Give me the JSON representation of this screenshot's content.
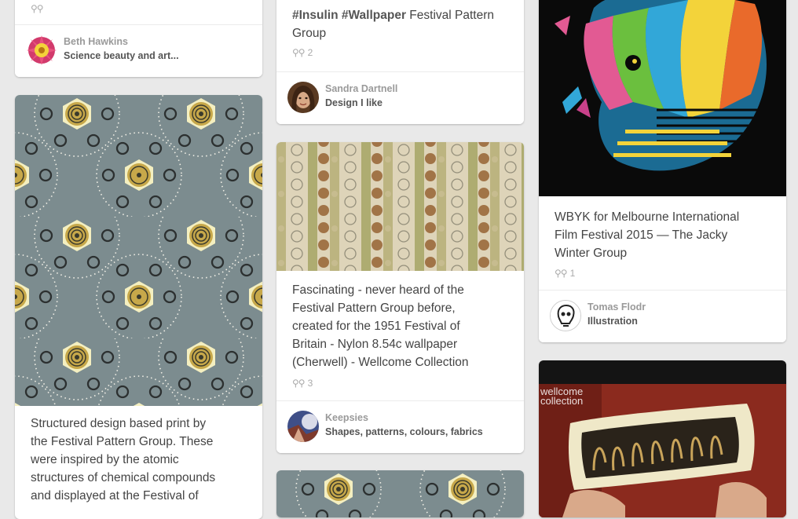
{
  "pins": [
    {
      "repin_count": "",
      "user": "Beth Hawkins",
      "board": "Science beauty and art..."
    },
    {
      "desc_hash": "#Insulin #Wallpaper",
      "desc_rest": " Festival Pattern Group",
      "repin_count": "2",
      "user": "Sandra Dartnell",
      "board": "Design I like"
    },
    {
      "desc_lines": [
        "WBYK for Melbourne International",
        "Film Festival 2015 — The Jacky",
        "Winter Group"
      ],
      "repin_count": "1",
      "user": "Tomas Flodr",
      "board": "Illustration"
    },
    {
      "desc_lines": [
        "Structured design based print by",
        "the Festival Pattern Group. These",
        "were inspired by the atomic",
        "structures of chemical compounds",
        "and displayed at the Festival of"
      ]
    },
    {
      "desc_lines": [
        "Fascinating - never heard of the",
        "Festival Pattern Group before,",
        "created for the 1951 Festival of",
        "Britain - Nylon 8.54c wallpaper",
        "(Cherwell) - Wellcome Collection"
      ],
      "repin_count": "3",
      "user": "Keepsies",
      "board": "Shapes, patterns, colours, fabrics"
    },
    {
      "overlay_text": "wellcome collection"
    }
  ],
  "icons": {
    "repin": "pushpin-icon"
  },
  "colors": {
    "background": "#e9e9e9",
    "card": "#ffffff"
  }
}
